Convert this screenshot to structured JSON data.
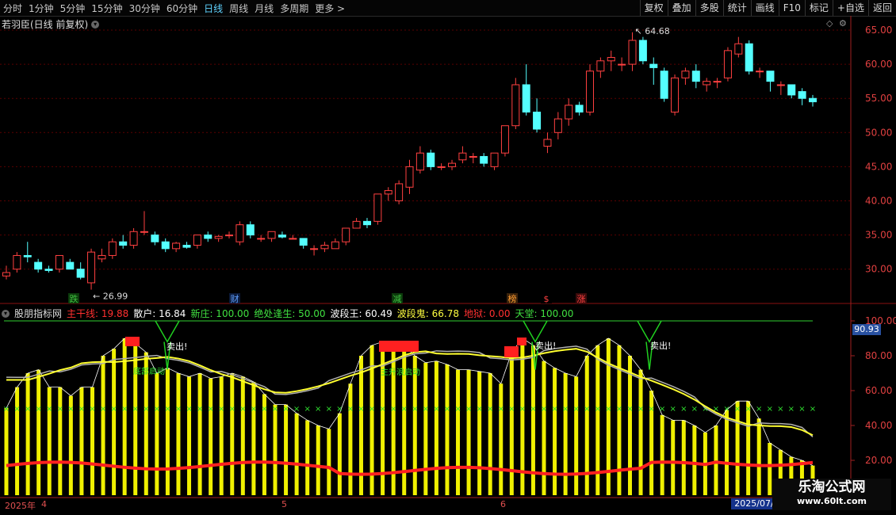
{
  "toolbar": {
    "periods": [
      "分时",
      "1分钟",
      "5分钟",
      "15分钟",
      "30分钟",
      "60分钟",
      "日线",
      "周线",
      "月线",
      "多周期",
      "更多 >"
    ],
    "active_period": "日线",
    "tools": [
      "复权",
      "叠加",
      "多股",
      "统计",
      "画线",
      "F10",
      "标记",
      "+自选",
      "返回"
    ]
  },
  "chart_title": "若羽臣(日线 前复权)",
  "price_axis": [
    "65.00",
    "60.00",
    "55.00",
    "50.00",
    "45.00",
    "40.00",
    "35.00",
    "30.00"
  ],
  "high_label": "64.68",
  "low_label": "26.99",
  "event_tags": [
    {
      "text": "跌",
      "color": "#40c040",
      "bg": "#0b3a0b"
    },
    {
      "text": "财",
      "color": "#60a0ff",
      "bg": "#0b1a3a"
    },
    {
      "text": "减",
      "color": "#40c040",
      "bg": "#0b3a0b"
    },
    {
      "text": "榜",
      "color": "#ff9c30",
      "bg": "#3a220b"
    },
    {
      "text": "$",
      "color": "#ff4040",
      "bg": "#000"
    },
    {
      "text": "涨",
      "color": "#ff4040",
      "bg": "#3a0b0b"
    }
  ],
  "indicator": {
    "name": "股朋指标网",
    "fields": [
      {
        "label": "主干线:",
        "value": "19.88",
        "color": "#ff3030"
      },
      {
        "label": "散户:",
        "value": "16.84",
        "color": "#ffffff"
      },
      {
        "label": "新庄:",
        "value": "100.00",
        "color": "#40e040"
      },
      {
        "label": "绝处逢生:",
        "value": "50.00",
        "color": "#40e040"
      },
      {
        "label": "波段王:",
        "value": "60.49",
        "color": "#ffffff"
      },
      {
        "label": "波段鬼:",
        "value": "66.78",
        "color": "#ffff40"
      },
      {
        "label": "地狱:",
        "value": "0.00",
        "color": "#ff3030"
      },
      {
        "label": "天堂:",
        "value": "100.00",
        "color": "#40e040"
      }
    ],
    "axis": [
      "100.00",
      "80.00",
      "60.00",
      "40.00",
      "20.00"
    ],
    "current_value": "90.93",
    "sell_label": "卖出!",
    "bottom_label": "底部启动",
    "rally_label": "主升浪启动"
  },
  "x_axis": {
    "labels": [
      "2025年",
      "4",
      "5",
      "6"
    ],
    "current_date": "2025/07/"
  },
  "colors": {
    "up": "#ff4040",
    "down": "#54ffff",
    "grid": "#5a0000",
    "axis": "#a02020"
  },
  "watermark": {
    "title": "乐淘公式网",
    "url": "www.60lt.com"
  }
}
